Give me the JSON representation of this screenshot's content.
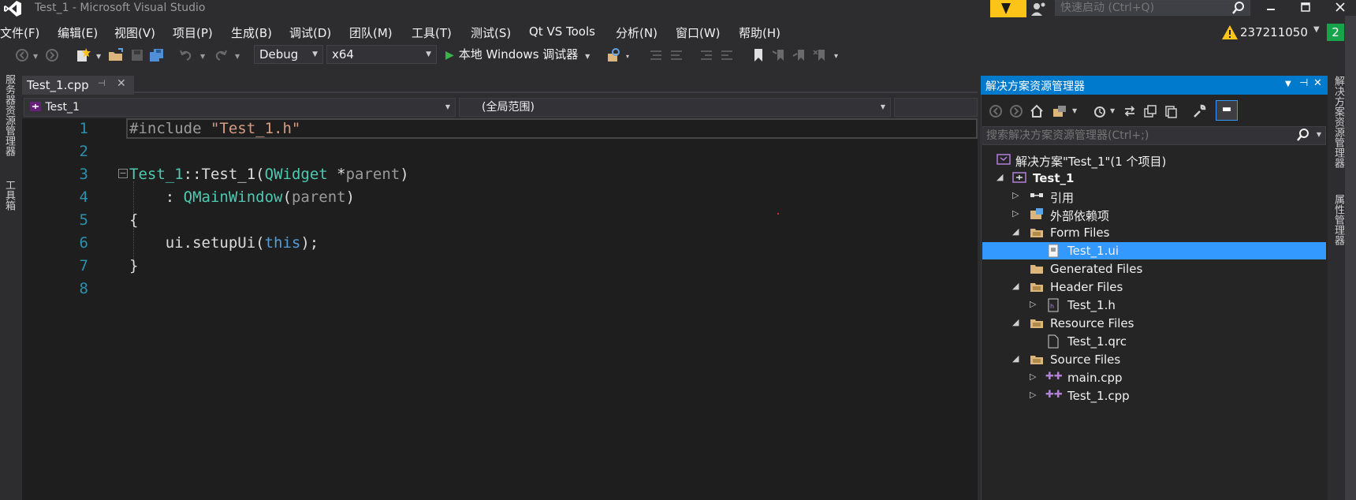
{
  "window": {
    "title": "Test_1 - Microsoft Visual Studio",
    "quick_launch_placeholder": "快速启动 (Ctrl+Q)",
    "account": "237211050",
    "notification_count": "2"
  },
  "menu": [
    {
      "label": "文件(F)"
    },
    {
      "label": "编辑(E)"
    },
    {
      "label": "视图(V)"
    },
    {
      "label": "项目(P)"
    },
    {
      "label": "生成(B)"
    },
    {
      "label": "调试(D)"
    },
    {
      "label": "团队(M)"
    },
    {
      "label": "工具(T)"
    },
    {
      "label": "测试(S)"
    },
    {
      "label": "Qt VS Tools"
    },
    {
      "label": "分析(N)"
    },
    {
      "label": "窗口(W)"
    },
    {
      "label": "帮助(H)"
    }
  ],
  "toolbar": {
    "configuration": "Debug",
    "platform": "x64",
    "run_label": "本地 Windows 调试器"
  },
  "left_strip": {
    "server_explorer": "服务器资源管理器",
    "toolbox": "工具箱"
  },
  "editor": {
    "tab_label": "Test_1.cpp",
    "nav_project": "Test_1",
    "nav_scope": "(全局范围)",
    "line_numbers": [
      "1",
      "2",
      "3",
      "4",
      "5",
      "6",
      "7",
      "8"
    ],
    "code": {
      "line1_a": "#include ",
      "line1_b": "\"Test_1.h\"",
      "line3_a": "Test_1",
      "line3_b": "::",
      "line3_c": "Test_1",
      "line3_d": "(",
      "line3_e": "QWidget",
      "line3_f": " *",
      "line3_g": "parent",
      "line3_h": ")",
      "line4_a": "    : ",
      "line4_b": "QMainWindow",
      "line4_c": "(",
      "line4_d": "parent",
      "line4_e": ")",
      "line5": "{",
      "line6_a": "    ui.setupUi(",
      "line6_b": "this",
      "line6_c": ");",
      "line7": "}"
    }
  },
  "solution_explorer": {
    "title": "解决方案资源管理器",
    "search_placeholder": "搜索解决方案资源管理器(Ctrl+;)",
    "tree": {
      "solution": "解决方案\"Test_1\"(1 个项目)",
      "project": "Test_1",
      "references": "引用",
      "external_deps": "外部依赖项",
      "form_files": "Form Files",
      "test_ui": "Test_1.ui",
      "generated_files": "Generated Files",
      "header_files": "Header Files",
      "test_h": "Test_1.h",
      "resource_files": "Resource Files",
      "test_qrc": "Test_1.qrc",
      "source_files": "Source Files",
      "main_cpp": "main.cpp",
      "test_cpp": "Test_1.cpp"
    }
  },
  "right_strip": {
    "solution_explorer": "解决方案资源管理器",
    "properties": "属性管理器"
  },
  "colors": {
    "accent": "#007acc",
    "selection": "#3399ff",
    "keyword": "#569cd6",
    "type": "#4ec9b0",
    "string": "#d69d85",
    "line_number": "#2b91af",
    "param": "#9a9a9a"
  }
}
